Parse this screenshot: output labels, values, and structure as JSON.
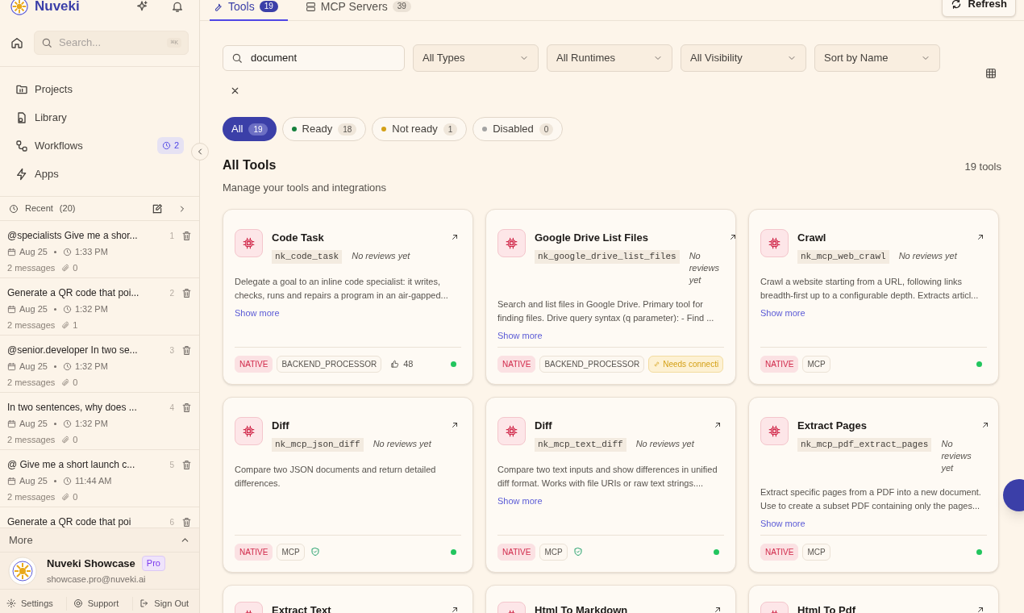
{
  "app": {
    "name": "Nuveki"
  },
  "sidebar": {
    "search": {
      "placeholder": "Search...",
      "shortcut": "⌘K"
    },
    "nav": [
      {
        "label": "Projects"
      },
      {
        "label": "Library"
      },
      {
        "label": "Workflows",
        "badge": "2"
      },
      {
        "label": "Apps"
      }
    ],
    "recent": {
      "label": "Recent",
      "count": "(20)",
      "items": [
        {
          "title": "@specialists Give me a shor...",
          "index": "1",
          "date": "Aug 25",
          "time": "1:33 PM",
          "messages": "2 messages",
          "attachments": "0"
        },
        {
          "title": "Generate a QR code that poi...",
          "index": "2",
          "date": "Aug 25",
          "time": "1:32 PM",
          "messages": "2 messages",
          "attachments": "1"
        },
        {
          "title": "@senior.developer In two se...",
          "index": "3",
          "date": "Aug 25",
          "time": "1:32 PM",
          "messages": "2 messages",
          "attachments": "0"
        },
        {
          "title": "In two sentences, why does ...",
          "index": "4",
          "date": "Aug 25",
          "time": "1:32 PM",
          "messages": "2 messages",
          "attachments": "0"
        },
        {
          "title": "@ Give me a short launch c...",
          "index": "5",
          "date": "Aug 25",
          "time": "11:44 AM",
          "messages": "2 messages",
          "attachments": "0"
        },
        {
          "title": "Generate a QR code that poi",
          "index": "6"
        }
      ]
    },
    "more": {
      "label": "More",
      "expanded": true
    },
    "user": {
      "name": "Nuveki Showcase",
      "plan": "Pro",
      "email": "showcase.pro@nuveki.ai"
    },
    "footer_links": [
      {
        "label": "Settings"
      },
      {
        "label": "Support"
      },
      {
        "label": "Sign Out"
      }
    ]
  },
  "tabs": [
    {
      "label": "Tools",
      "count": "19",
      "selected": true
    },
    {
      "label": "MCP Servers",
      "count": "39",
      "selected": false
    }
  ],
  "refresh": "Refresh",
  "filters": {
    "search_value": "document",
    "selects": [
      "All Types",
      "All Runtimes",
      "All Visibility",
      "Sort by Name"
    ]
  },
  "status_filters": [
    {
      "label": "All",
      "count": "19",
      "selected": true
    },
    {
      "label": "Ready",
      "count": "18",
      "selected": false,
      "color": "#15803d"
    },
    {
      "label": "Not ready",
      "count": "1",
      "selected": false,
      "color": "#d4a017"
    },
    {
      "label": "Disabled",
      "count": "0",
      "selected": false,
      "color": "#a3a3a3"
    }
  ],
  "section": {
    "title": "All Tools",
    "subtitle": "Manage your tools and integrations",
    "count": "19 tools"
  },
  "tools": [
    {
      "title": "Code Task",
      "slug": "nk_code_task",
      "reviews": "No reviews yet",
      "description": "Delegate a goal to an inline code specialist: it writes, checks, runs and repairs a program in an air-gapped...",
      "show_more": "Show more",
      "tags": [
        {
          "label": "NATIVE",
          "kind": "native"
        },
        {
          "label": "BACKEND_PROCESSOR",
          "kind": "plain"
        }
      ],
      "likes": "48",
      "verified": false,
      "color": "#22c55e"
    },
    {
      "title": "Google Drive List Files",
      "slug": "nk_google_drive_list_files",
      "reviews": "No reviews yet",
      "description": "Search and list files in Google Drive. Primary tool for finding files. Drive query syntax (q parameter): - Find ...",
      "show_more": "Show more",
      "tags": [
        {
          "label": "NATIVE",
          "kind": "native"
        },
        {
          "label": "BACKEND_PROCESSOR",
          "kind": "plain"
        },
        {
          "label": "Needs connecti",
          "kind": "warning"
        }
      ],
      "verified": false
    },
    {
      "title": "Crawl",
      "slug": "nk_mcp_web_crawl",
      "reviews": "No reviews yet",
      "description": "Crawl a website starting from a URL, following links breadth-first up to a configurable depth. Extracts articl...",
      "show_more": "Show more",
      "tags": [
        {
          "label": "NATIVE",
          "kind": "native"
        },
        {
          "label": "MCP",
          "kind": "plain"
        }
      ],
      "verified": false,
      "color": "#22c55e"
    },
    {
      "title": "Diff",
      "slug": "nk_mcp_json_diff",
      "reviews": "No reviews yet",
      "description": "Compare two JSON documents and return detailed differences.",
      "tags": [
        {
          "label": "NATIVE",
          "kind": "native"
        },
        {
          "label": "MCP",
          "kind": "plain"
        }
      ],
      "verified": true,
      "color": "#22c55e"
    },
    {
      "title": "Diff",
      "slug": "nk_mcp_text_diff",
      "reviews": "No reviews yet",
      "description": "Compare two text inputs and show differences in unified diff format. Works with file URIs or raw text strings....",
      "show_more": "Show more",
      "tags": [
        {
          "label": "NATIVE",
          "kind": "native"
        },
        {
          "label": "MCP",
          "kind": "plain"
        }
      ],
      "verified": true,
      "color": "#22c55e"
    },
    {
      "title": "Extract Pages",
      "slug": "nk_mcp_pdf_extract_pages",
      "reviews": "No reviews yet",
      "description": "Extract specific pages from a PDF into a new document. Use to create a subset PDF containing only the pages...",
      "show_more": "Show more",
      "tags": [
        {
          "label": "NATIVE",
          "kind": "native"
        },
        {
          "label": "MCP",
          "kind": "plain"
        }
      ],
      "verified": false,
      "color": "#22c55e"
    },
    {
      "title": "Extract Text"
    },
    {
      "title": "Html To Markdown"
    },
    {
      "title": "Html To Pdf"
    }
  ]
}
